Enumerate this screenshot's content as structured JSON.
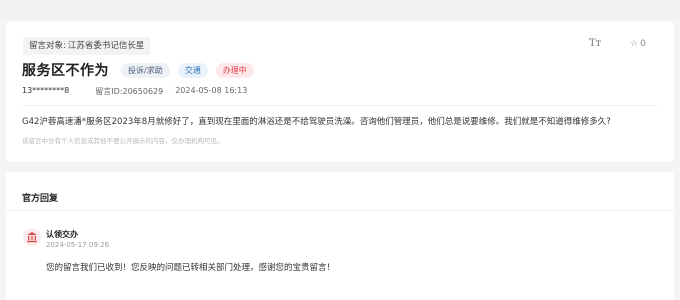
{
  "message": {
    "target_prefix": "留言对象:",
    "target_name": "江苏省委书记信长星",
    "font_size_label": "Tт",
    "star_count": "0",
    "title": "服务区不作为",
    "badges": {
      "category": "投诉/求助",
      "topic": "交通",
      "status": "办理中"
    },
    "user_id": "13********8",
    "message_id": "留言ID:20650629",
    "date": "2024-05-08 16:13",
    "content": "G42沪蓉高速潘*服务区2023年8月就修好了，直到现在里面的淋浴还是不给驾驶员洗澡。咨询他们管理员，他们总是说要维修。我们就是不知道得维修多久?",
    "notice": "该留言中含有个人信息或其他不便公开展示的内容，仅办理机构可见。"
  },
  "reply": {
    "section_title": "官方回复",
    "org_name": "认领交办",
    "time": "2024-05-17 09:26",
    "text": "您的留言我们已收到！您反映的问题已转相关部门处理，感谢您的宝贵留言！"
  },
  "colors": {
    "status_red": "#e23c4b",
    "topic_blue": "#2f6cb3",
    "org_icon_red": "#d94a4a"
  },
  "icons": {
    "star": "star-icon",
    "font_size": "font-size-icon",
    "org": "government-building-icon"
  }
}
